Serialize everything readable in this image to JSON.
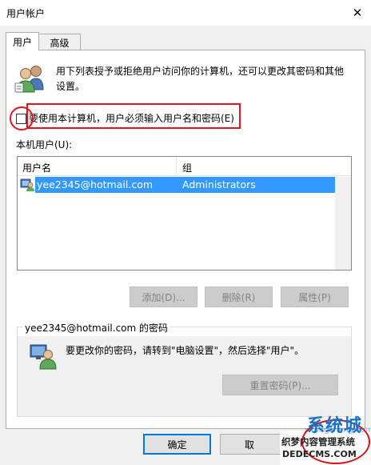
{
  "window": {
    "title": "用户帐户",
    "close_glyph": "✕"
  },
  "tabs": [
    {
      "label": "用户",
      "selected": true
    },
    {
      "label": "高级",
      "selected": false
    }
  ],
  "intro": {
    "text": "用下列表授予或拒绝用户访问你的计算机，还可以更改其密码和其他设置。"
  },
  "require_login": {
    "label": "要使用本计算机，用户必须输入用户名和密码(E)",
    "checked": false
  },
  "users_list": {
    "label": "本机用户(U):",
    "columns": [
      "用户名",
      "组"
    ],
    "rows": [
      {
        "name": "yee2345@hotmail.com",
        "group": "Administrators",
        "selected": true
      }
    ]
  },
  "user_buttons": {
    "add": "添加(D)...",
    "remove": "删除(R)",
    "properties": "属性(P)"
  },
  "password_group": {
    "title": "yee2345@hotmail.com 的密码",
    "text": "要更改你的密码，请转到\"电脑设置\"，然后选择\"用户\"。",
    "reset_button": "重置密码(P)..."
  },
  "dialog_buttons": {
    "ok": "确定",
    "cancel": "取"
  },
  "watermark": {
    "brand": "系统城",
    "faint": "xitongcheng.com",
    "name": "织梦内容管理系统",
    "url": "DEDECMS.COM"
  },
  "colors": {
    "accent": "#0078d7",
    "selection": "#3399ff",
    "annotation": "#e5131d",
    "watermark_blue": "#1a73c9"
  }
}
